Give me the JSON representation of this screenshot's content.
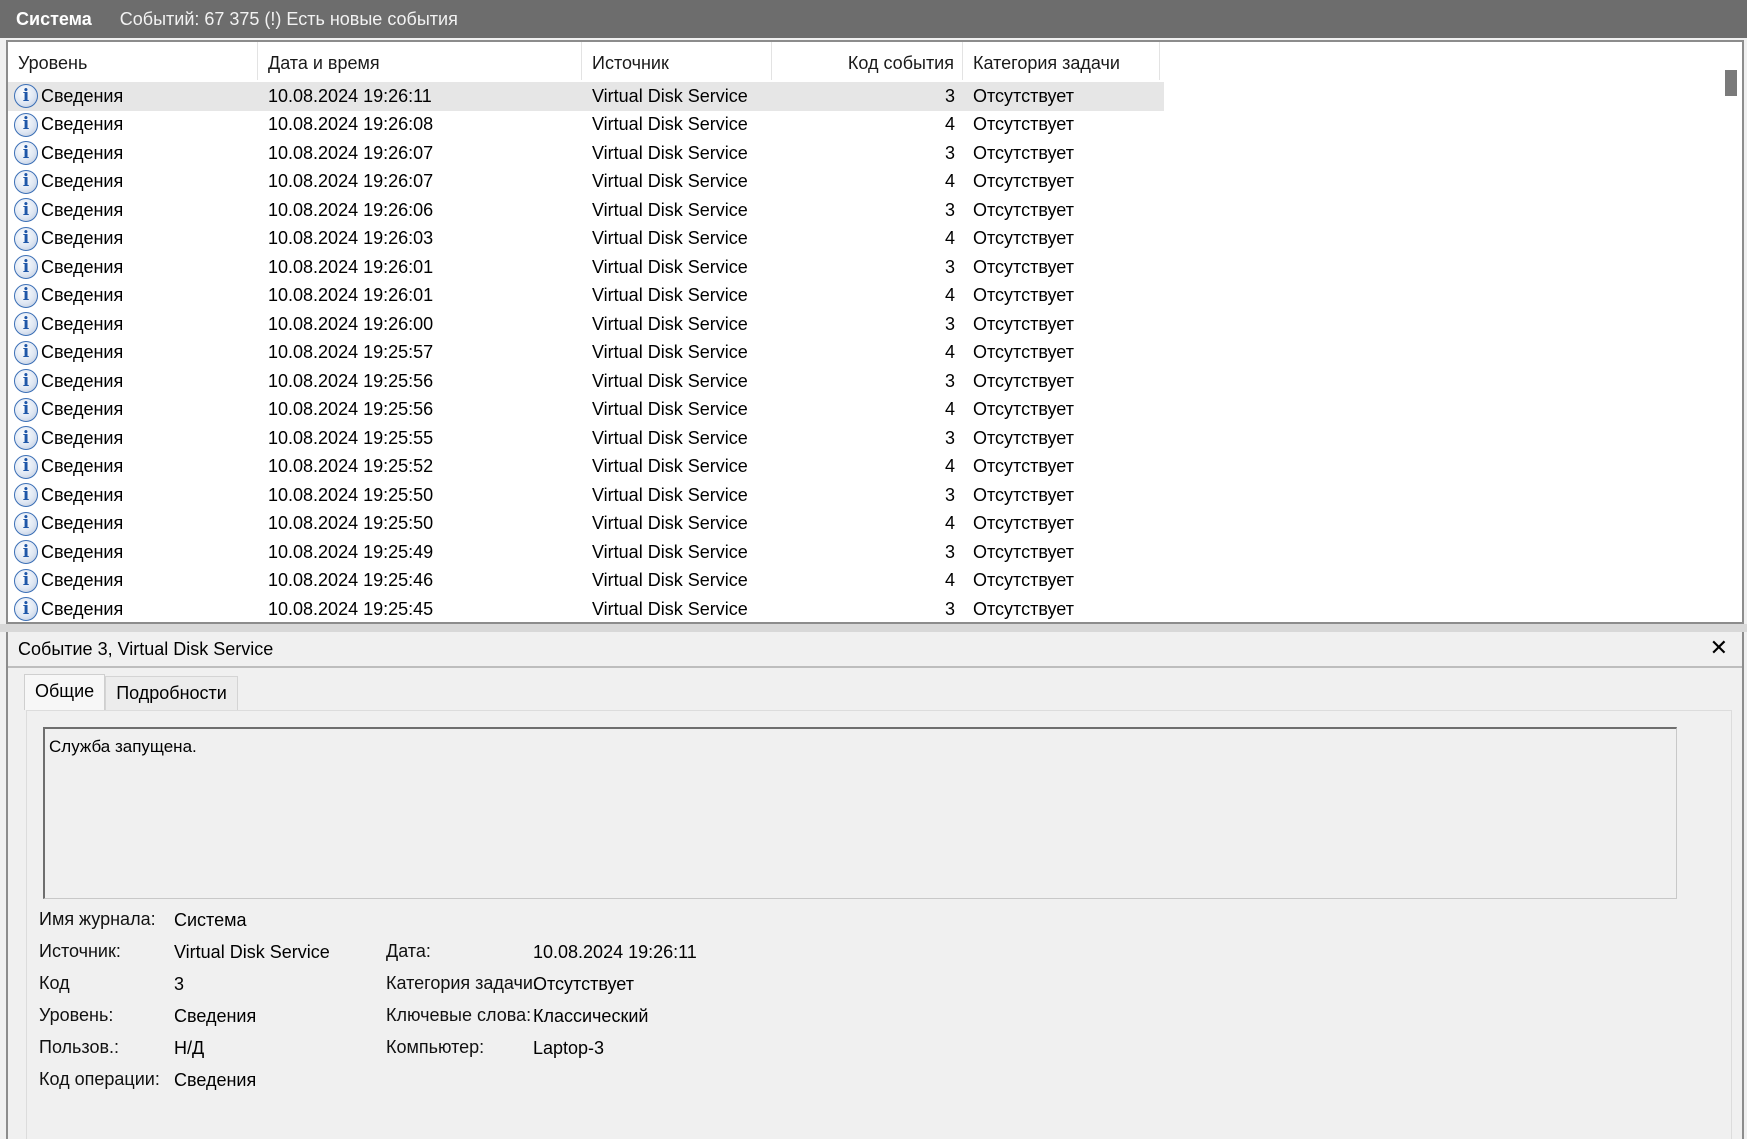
{
  "titlebar": {
    "title": "Система",
    "info": "Событий: 67 375 (!) Есть новые события"
  },
  "grid": {
    "columns": [
      "Уровень",
      "Дата и время",
      "Источник",
      "Код события",
      "Категория задачи"
    ],
    "rows": [
      {
        "level": "Сведения",
        "date": "10.08.2024 19:26:11",
        "source": "Virtual Disk Service",
        "code": "3",
        "category": "Отсутствует"
      },
      {
        "level": "Сведения",
        "date": "10.08.2024 19:26:08",
        "source": "Virtual Disk Service",
        "code": "4",
        "category": "Отсутствует"
      },
      {
        "level": "Сведения",
        "date": "10.08.2024 19:26:07",
        "source": "Virtual Disk Service",
        "code": "3",
        "category": "Отсутствует"
      },
      {
        "level": "Сведения",
        "date": "10.08.2024 19:26:07",
        "source": "Virtual Disk Service",
        "code": "4",
        "category": "Отсутствует"
      },
      {
        "level": "Сведения",
        "date": "10.08.2024 19:26:06",
        "source": "Virtual Disk Service",
        "code": "3",
        "category": "Отсутствует"
      },
      {
        "level": "Сведения",
        "date": "10.08.2024 19:26:03",
        "source": "Virtual Disk Service",
        "code": "4",
        "category": "Отсутствует"
      },
      {
        "level": "Сведения",
        "date": "10.08.2024 19:26:01",
        "source": "Virtual Disk Service",
        "code": "3",
        "category": "Отсутствует"
      },
      {
        "level": "Сведения",
        "date": "10.08.2024 19:26:01",
        "source": "Virtual Disk Service",
        "code": "4",
        "category": "Отсутствует"
      },
      {
        "level": "Сведения",
        "date": "10.08.2024 19:26:00",
        "source": "Virtual Disk Service",
        "code": "3",
        "category": "Отсутствует"
      },
      {
        "level": "Сведения",
        "date": "10.08.2024 19:25:57",
        "source": "Virtual Disk Service",
        "code": "4",
        "category": "Отсутствует"
      },
      {
        "level": "Сведения",
        "date": "10.08.2024 19:25:56",
        "source": "Virtual Disk Service",
        "code": "3",
        "category": "Отсутствует"
      },
      {
        "level": "Сведения",
        "date": "10.08.2024 19:25:56",
        "source": "Virtual Disk Service",
        "code": "4",
        "category": "Отсутствует"
      },
      {
        "level": "Сведения",
        "date": "10.08.2024 19:25:55",
        "source": "Virtual Disk Service",
        "code": "3",
        "category": "Отсутствует"
      },
      {
        "level": "Сведения",
        "date": "10.08.2024 19:25:52",
        "source": "Virtual Disk Service",
        "code": "4",
        "category": "Отсутствует"
      },
      {
        "level": "Сведения",
        "date": "10.08.2024 19:25:50",
        "source": "Virtual Disk Service",
        "code": "3",
        "category": "Отсутствует"
      },
      {
        "level": "Сведения",
        "date": "10.08.2024 19:25:50",
        "source": "Virtual Disk Service",
        "code": "4",
        "category": "Отсутствует"
      },
      {
        "level": "Сведения",
        "date": "10.08.2024 19:25:49",
        "source": "Virtual Disk Service",
        "code": "3",
        "category": "Отсутствует"
      },
      {
        "level": "Сведения",
        "date": "10.08.2024 19:25:46",
        "source": "Virtual Disk Service",
        "code": "4",
        "category": "Отсутствует"
      },
      {
        "level": "Сведения",
        "date": "10.08.2024 19:25:45",
        "source": "Virtual Disk Service",
        "code": "3",
        "category": "Отсутствует"
      }
    ],
    "selected_index": 0,
    "level_icon": "info-icon"
  },
  "detail": {
    "header": "Событие 3, Virtual Disk Service",
    "close_icon": "close-icon",
    "tabs": [
      {
        "label": "Общие",
        "active": true
      },
      {
        "label": "Подробности",
        "active": false
      }
    ],
    "description": "Служба запущена.",
    "props": {
      "log_name_label": "Имя журнала:",
      "log_name": "Система",
      "source_label": "Источник:",
      "source": "Virtual Disk Service",
      "date_label": "Дата:",
      "date": "10.08.2024 19:26:11",
      "code_label": "Код",
      "code": "3",
      "category_label": "Категория задачи:",
      "category": "Отсутствует",
      "level_label": "Уровень:",
      "level": "Сведения",
      "keywords_label": "Ключевые слова:",
      "keywords": "Классический",
      "user_label": "Пользов.:",
      "user": "Н/Д",
      "computer_label": "Компьютер:",
      "computer": "Laptop-3",
      "opcode_label": "Код операции:",
      "opcode": "Сведения"
    }
  }
}
